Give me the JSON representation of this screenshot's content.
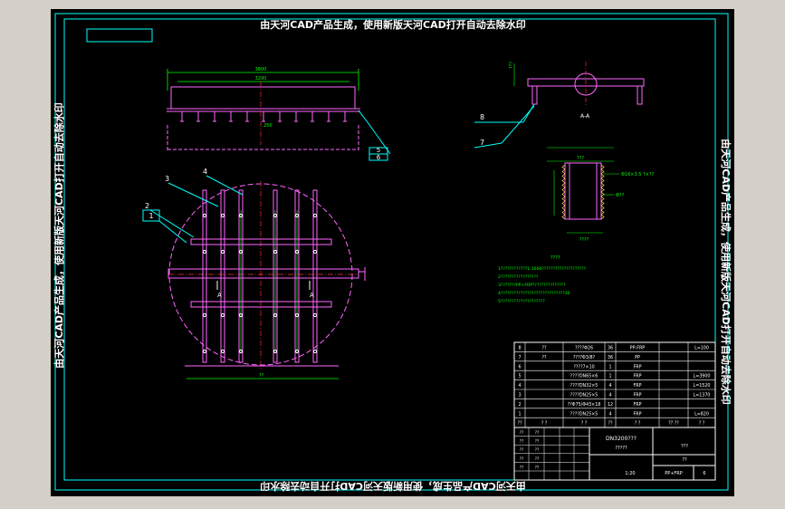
{
  "colors": {
    "background": "#000000",
    "frame": "#00ffff",
    "title_text": "#ffffff",
    "part": "#ff66ff",
    "dim": "#00ff00",
    "label": "#ffffff",
    "center": "#ff3030",
    "window_bg": "#d4d0c8"
  },
  "watermark": {
    "top": "由天河CAD产品生成，使用新版天河CAD打开自动去除水印",
    "left": "由天河CAD产品生成，使用新版天河CAD打开自动去除水印",
    "right": "由天河CAD产品生成，使用新版天河CAD打开自动去除水印",
    "bottom": "由天河CAD产品生成，使用新版天河CAD打开自动去除水印"
  },
  "callouts": {
    "c1": "1",
    "c2": "2",
    "c3": "3",
    "c4": "4",
    "c5": "5",
    "c6": "6",
    "c7": "7",
    "c8": "8"
  },
  "section_label": "A-A",
  "view_marks": {
    "a1": "A",
    "a2": "A"
  },
  "dimensions": {
    "overall_width": "3800",
    "inner_width": "3200",
    "pipe_height": "250",
    "small_dim": "??",
    "detail_width": "???",
    "detail_bottom": "????",
    "detail_side": "Φ??",
    "detail_note": "Φ16×3.5 ?×??",
    "pipe_note": "???"
  },
  "notes": {
    "heading": "????",
    "lines": [
      "1????????????1:1600????????????????????",
      "2?????????????????",
      "3???????PP+FRP???????????????",
      "4?????????????????????????????30",
      "5????????????????????"
    ]
  },
  "bom": {
    "rows": [
      [
        "8",
        "??",
        "????Φ26",
        "36",
        "PP-FRP",
        "",
        "L=100"
      ],
      [
        "7",
        "??",
        "????Φ3/8?",
        "36",
        "PP",
        "",
        ""
      ],
      [
        "6",
        "",
        "????7×10",
        "1",
        "FRP",
        "",
        ""
      ],
      [
        "5",
        "",
        "????DN65×6",
        "1",
        "FRP",
        "",
        "L=3900"
      ],
      [
        "4",
        "",
        "????DN32×5",
        "4",
        "FRP",
        "",
        "L=1520"
      ],
      [
        "3",
        "",
        "????DN25×5",
        "4",
        "FRP",
        "",
        "L=1370"
      ],
      [
        "2",
        "",
        "??Φ75/Φ43×18",
        "12",
        "FRP",
        "",
        ""
      ],
      [
        "1",
        "",
        "????DN25×5",
        "4",
        "FRP",
        "",
        "L=820"
      ],
      [
        "??",
        "? ?",
        "? ?",
        "??",
        "? ?",
        "?? ??",
        "? ?"
      ]
    ]
  },
  "title_block": {
    "drawing_name": "DN3200???",
    "drawing_sub": "?????",
    "material": "PP+FRP",
    "sheet": "6",
    "scale": "1:20",
    "company": "???",
    "project": "??",
    "labels": [
      "??",
      "??",
      "??",
      "??",
      "??",
      "??",
      "??",
      "??",
      "??",
      "??"
    ]
  }
}
